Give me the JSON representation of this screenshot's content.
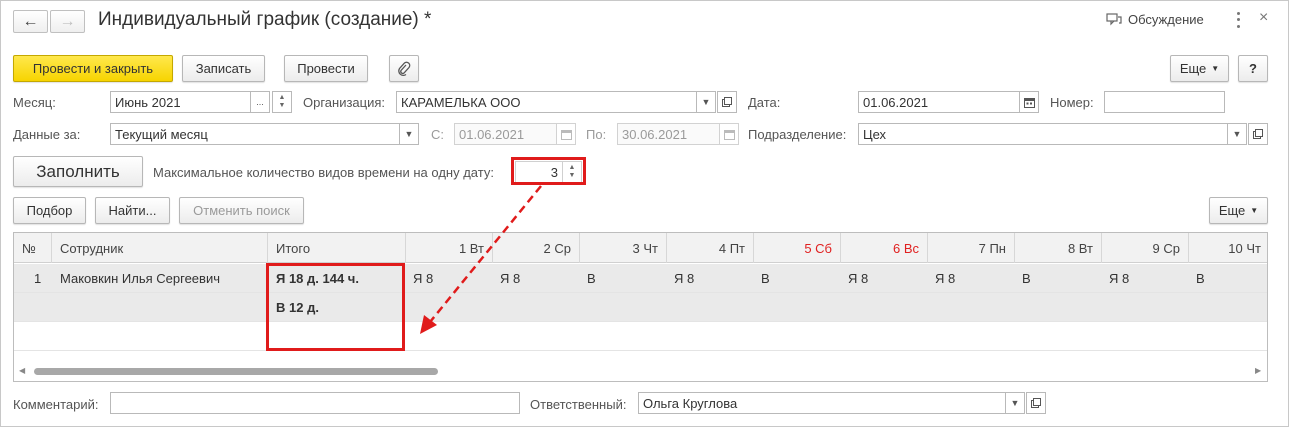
{
  "window": {
    "title": "Индивидуальный график (создание) *",
    "discussion_label": "Обсуждение"
  },
  "nav": {
    "back_icon": "←",
    "forward_icon": "→"
  },
  "toolbar": {
    "post_close_label": "Провести и закрыть",
    "write_label": "Записать",
    "post_label": "Провести",
    "more_label": "Еще",
    "help_label": "?"
  },
  "form": {
    "month_label": "Месяц:",
    "month_value": "Июнь 2021",
    "org_label": "Организация:",
    "org_value": "КАРАМЕЛЬКА ООО",
    "date_label": "Дата:",
    "date_value": "01.06.2021",
    "number_label": "Номер:",
    "number_value": "",
    "data_for_label": "Данные за:",
    "data_for_value": "Текущий месяц",
    "from_label": "С:",
    "from_value": "01.06.2021",
    "to_label": "По:",
    "to_value": "30.06.2021",
    "dept_label": "Подразделение:",
    "dept_value": "Цех",
    "fill_label": "Заполнить",
    "max_types_label": "Максимальное количество видов времени на одну дату:",
    "max_types_value": "3",
    "comment_label": "Комментарий:",
    "comment_value": "",
    "responsible_label": "Ответственный:",
    "responsible_value": "Ольга Круглова"
  },
  "table_toolbar": {
    "pick_label": "Подбор",
    "find_label": "Найти...",
    "cancel_search_label": "Отменить поиск",
    "more_label": "Еще"
  },
  "table": {
    "columns": [
      "№",
      "Сотрудник",
      "Итого",
      "1 Вт",
      "2 Ср",
      "3 Чт",
      "4 Пт",
      "5 Сб",
      "6 Вс",
      "7 Пн",
      "8 Вт",
      "9 Ср",
      "10 Чт"
    ],
    "weekend_color": "#e02020",
    "rows": [
      {
        "num": "1",
        "employee": "Маковкин Илья Сергеевич",
        "total_1": "Я 18 д. 144 ч.",
        "total_2": "В 12 д.",
        "days": [
          "Я 8",
          "Я 8",
          "В",
          "Я 8",
          "В",
          "Я 8",
          "Я 8",
          "В",
          "Я 8",
          "В"
        ]
      }
    ]
  },
  "accent": {
    "primary_button": "#f7d400",
    "highlight": "#e01b1b"
  }
}
